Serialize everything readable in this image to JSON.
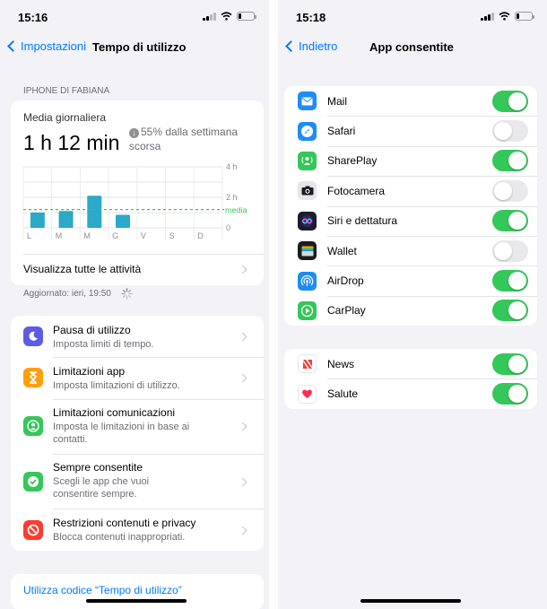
{
  "left": {
    "status_time": "15:16",
    "back_label": "Impostazioni",
    "title": "Tempo di utilizzo",
    "section_header": "IPHONE DI FABIANA",
    "summary": {
      "label": "Media giornaliera",
      "value": "1 h 12 min",
      "delta_text": "55% dalla settimana scorsa",
      "see_all": "Visualizza tutte le attività"
    },
    "updated": "Aggiornato: ieri, 19:50",
    "menu": [
      {
        "title": "Pausa di utilizzo",
        "subtitle": "Imposta limiti di tempo.",
        "icon": "moon-icon",
        "color": "#5e5ce6"
      },
      {
        "title": "Limitazioni app",
        "subtitle": "Imposta limitazioni di utilizzo.",
        "icon": "hourglass-icon",
        "color": "#ff9f0a"
      },
      {
        "title": "Limitazioni comunicazioni",
        "subtitle": "Imposta le limitazioni in base ai contatti.",
        "icon": "contact-icon",
        "color": "#34c759"
      },
      {
        "title": "Sempre consentite",
        "subtitle": "Scegli le app che vuoi consentire sempre.",
        "icon": "checkmark-icon",
        "color": "#34c759"
      },
      {
        "title": "Restrizioni contenuti e privacy",
        "subtitle": "Blocca contenuti inappropriati.",
        "icon": "restricted-icon",
        "color": "#ff3b30"
      }
    ],
    "bottom_link": "Utilizza codice “Tempo di utilizzo”"
  },
  "chart_data": {
    "type": "bar",
    "categories": [
      "L",
      "M",
      "M",
      "G",
      "V",
      "S",
      "D"
    ],
    "values": [
      1.0,
      1.1,
      2.1,
      0.85,
      0,
      0,
      0
    ],
    "average": 1.2,
    "average_label": "media",
    "y_ticks": [
      "4 h",
      "2 h",
      "0"
    ],
    "ylim": [
      0,
      4
    ],
    "bar_color": "#2aa9c8",
    "average_color": "#34c759",
    "grid": true
  },
  "right": {
    "status_time": "15:18",
    "back_label": "Indietro",
    "title": "App consentite",
    "apps_group1": [
      {
        "name": "Mail",
        "enabled": true,
        "icon": "mail-icon",
        "color": "#1e8cf5"
      },
      {
        "name": "Safari",
        "enabled": false,
        "icon": "compass-icon",
        "color": "#1e8cf5"
      },
      {
        "name": "SharePlay",
        "enabled": true,
        "icon": "shareplay-icon",
        "color": "#34c759"
      },
      {
        "name": "Fotocamera",
        "enabled": false,
        "icon": "camera-icon",
        "color": "#8e8e93"
      },
      {
        "name": "Siri e dettatura",
        "enabled": true,
        "icon": "siri-icon",
        "color": "#1c1c2e"
      },
      {
        "name": "Wallet",
        "enabled": false,
        "icon": "wallet-icon",
        "color": "#1c1c1e"
      },
      {
        "name": "AirDrop",
        "enabled": true,
        "icon": "airdrop-icon",
        "color": "#1e8cf5"
      },
      {
        "name": "CarPlay",
        "enabled": true,
        "icon": "carplay-icon",
        "color": "#34c759"
      }
    ],
    "apps_group2": [
      {
        "name": "News",
        "enabled": true,
        "icon": "news-icon",
        "color": "#ff3b30"
      },
      {
        "name": "Salute",
        "enabled": true,
        "icon": "heart-icon",
        "color": "#ff2d55"
      }
    ]
  }
}
